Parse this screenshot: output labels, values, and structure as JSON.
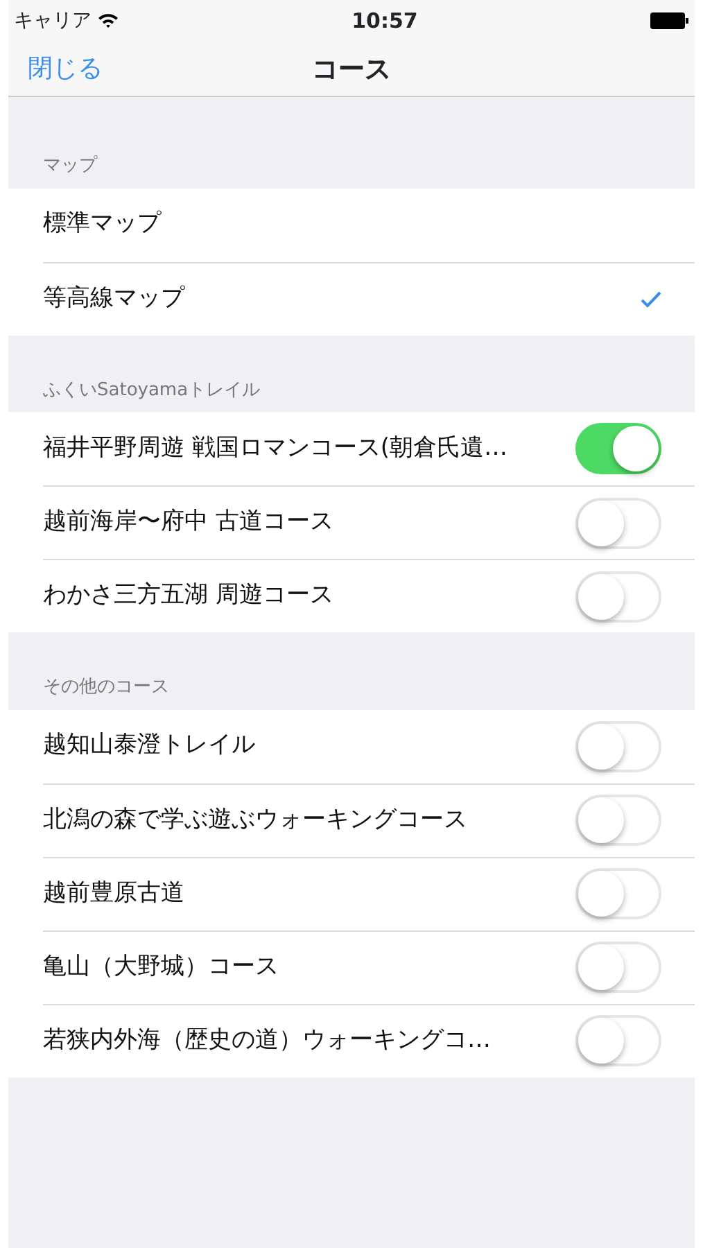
{
  "status_bar": {
    "carrier": "キャリア",
    "time": "10:57"
  },
  "nav": {
    "close": "閉じる",
    "title": "コース"
  },
  "sections": [
    {
      "header": "マップ",
      "kind": "choice",
      "items": [
        {
          "label": "標準マップ",
          "selected": false
        },
        {
          "label": "等高線マップ",
          "selected": true
        }
      ]
    },
    {
      "header": "ふくいSatoyamaトレイル",
      "kind": "toggle",
      "items": [
        {
          "label": "福井平野周遊 戦国ロマンコース(朝倉氏遺…",
          "on": true
        },
        {
          "label": "越前海岸〜府中 古道コース",
          "on": false
        },
        {
          "label": "わかさ三方五湖 周遊コース",
          "on": false
        }
      ]
    },
    {
      "header": "その他のコース",
      "kind": "toggle",
      "items": [
        {
          "label": "越知山泰澄トレイル",
          "on": false
        },
        {
          "label": "北潟の森で学ぶ遊ぶウォーキングコース",
          "on": false
        },
        {
          "label": "越前豊原古道",
          "on": false
        },
        {
          "label": "亀山（大野城）コース",
          "on": false
        },
        {
          "label": "若狭内外海（歴史の道）ウォーキングコ…",
          "on": false
        }
      ]
    }
  ]
}
